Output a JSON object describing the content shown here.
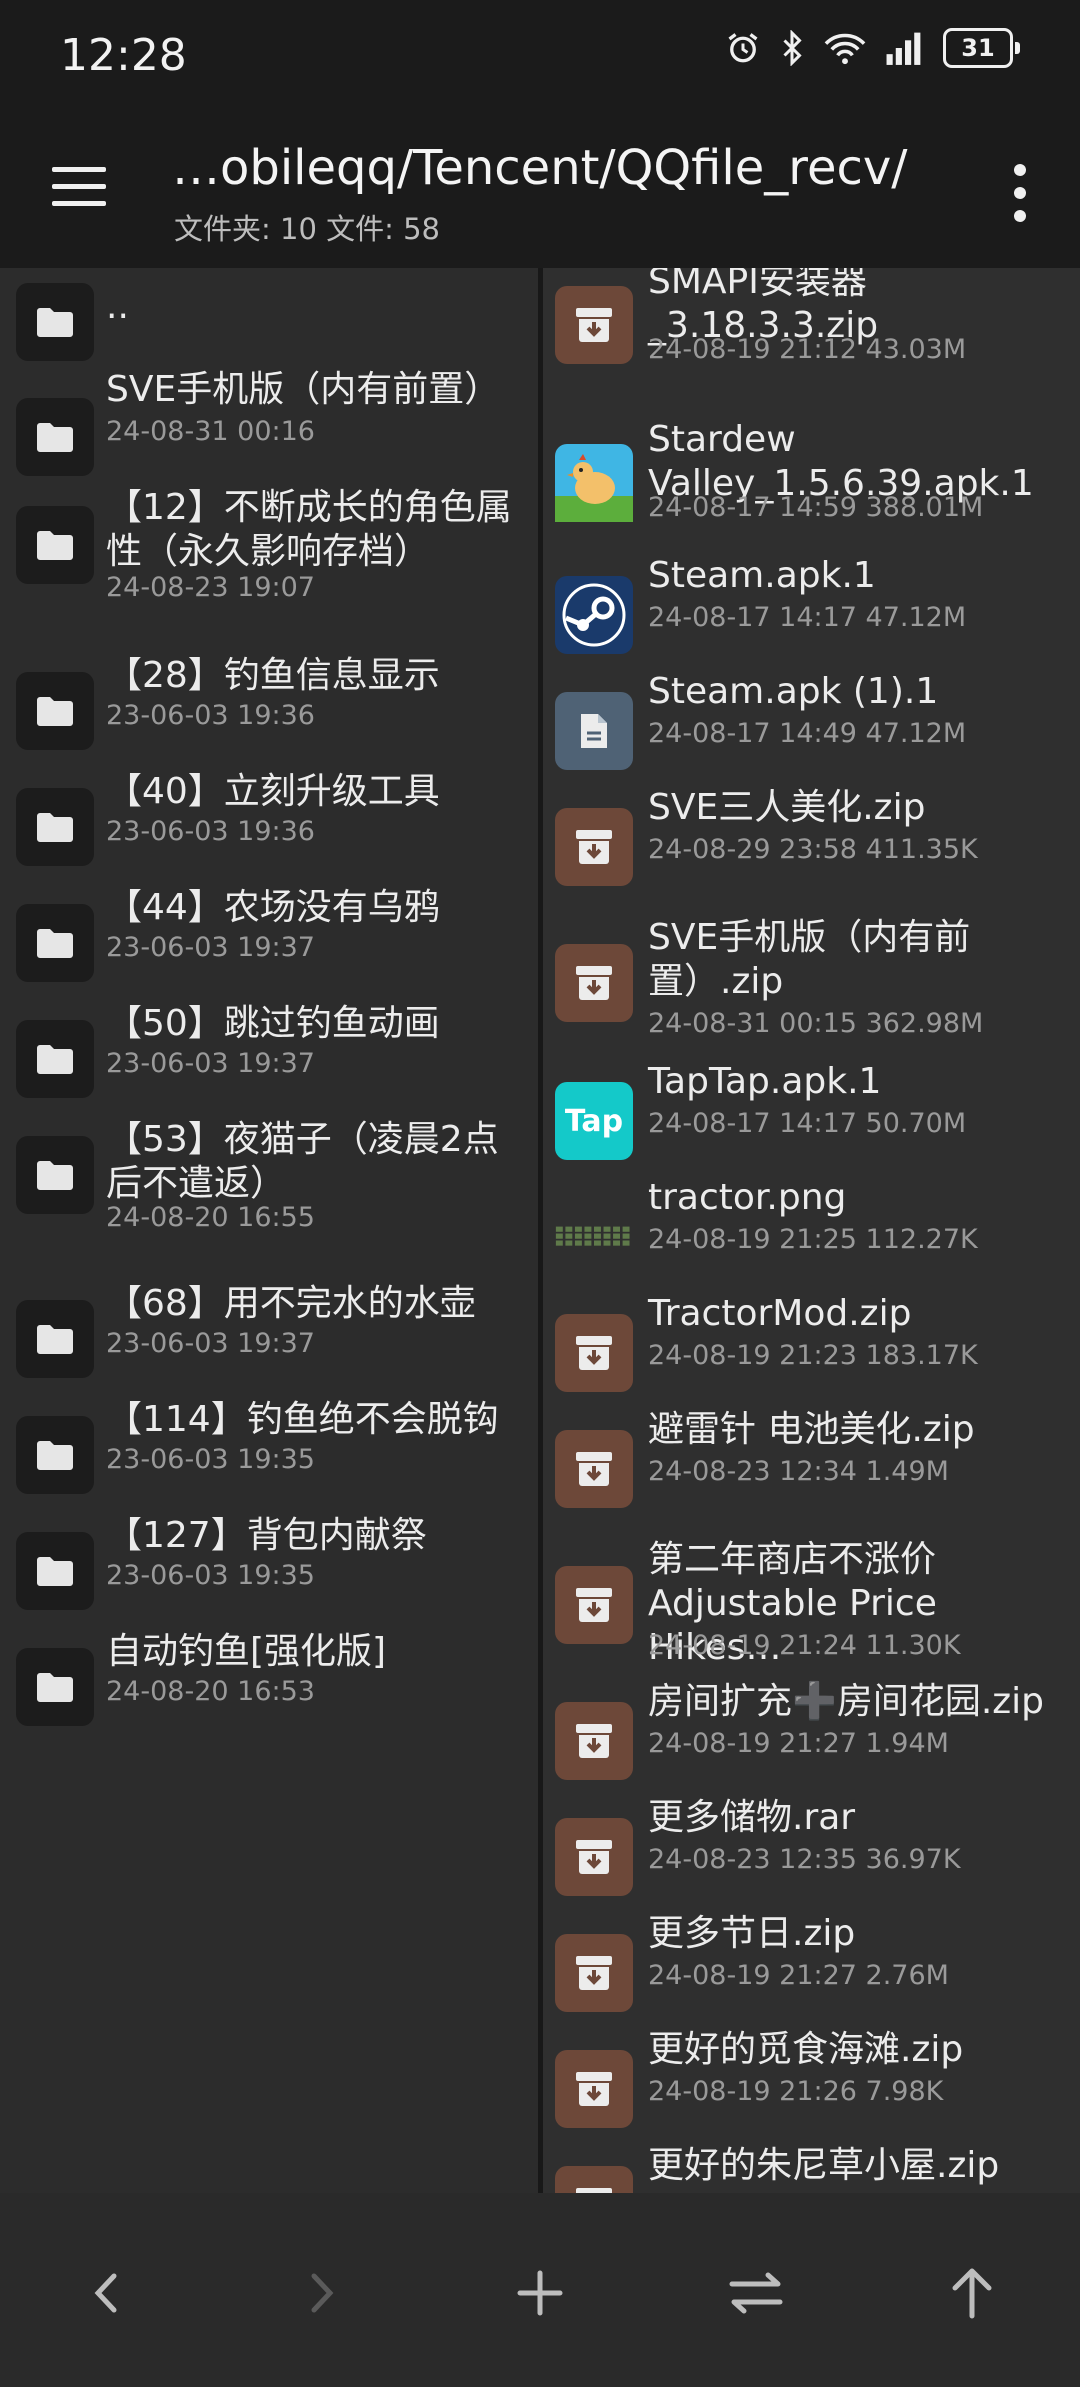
{
  "status": {
    "time": "12:28",
    "battery": "31"
  },
  "header": {
    "path": "…obileqq/Tencent/QQfile_recv/",
    "counts": "文件夹: 10  文件: 58"
  },
  "left": {
    "items": [
      {
        "name": "..",
        "meta": ""
      },
      {
        "name": "SVE手机版（内有前置）",
        "meta": "24-08-31 00:16"
      },
      {
        "name": "【12】不断成长的角色属性（永久影响存档）",
        "meta": "24-08-23 19:07"
      },
      {
        "name": "【28】钓鱼信息显示",
        "meta": "23-06-03 19:36"
      },
      {
        "name": "【40】立刻升级工具",
        "meta": "23-06-03 19:36"
      },
      {
        "name": "【44】农场没有乌鸦",
        "meta": "23-06-03 19:37"
      },
      {
        "name": "【50】跳过钓鱼动画",
        "meta": "23-06-03 19:37"
      },
      {
        "name": "【53】夜猫子（凌晨2点后不遣返）",
        "meta": "24-08-20 16:55"
      },
      {
        "name": "【68】用不完水的水壶",
        "meta": "23-06-03 19:37"
      },
      {
        "name": "【114】钓鱼绝不会脱钩",
        "meta": "23-06-03 19:35"
      },
      {
        "name": "【127】背包内献祭",
        "meta": "23-06-03 19:35"
      },
      {
        "name": "自动钓鱼[强化版]",
        "meta": "24-08-20 16:53"
      }
    ]
  },
  "right": {
    "items": [
      {
        "name": "SMAPI安装器_3.18.3.3.zip",
        "meta": "24-08-19 21:12  43.03M",
        "icon": "archive-icon"
      },
      {
        "name": "Stardew Valley_1.5.6.39.apk.1",
        "meta": "24-08-17 14:59  388.01M",
        "icon": "stardew-app-icon"
      },
      {
        "name": "Steam.apk.1",
        "meta": "24-08-17 14:17  47.12M",
        "icon": "steam-app-icon"
      },
      {
        "name": "Steam.apk (1).1",
        "meta": "24-08-17 14:49  47.12M",
        "icon": "document-icon"
      },
      {
        "name": "SVE三人美化.zip",
        "meta": "24-08-29 23:58  411.35K",
        "icon": "archive-icon"
      },
      {
        "name": "SVE手机版（内有前置）.zip",
        "meta": "24-08-31 00:15  362.98M",
        "icon": "archive-icon"
      },
      {
        "name": "TapTap.apk.1",
        "meta": "24-08-17 14:17  50.70M",
        "icon": "taptap-app-icon",
        "badge": "Tap"
      },
      {
        "name": "tractor.png",
        "meta": "24-08-19 21:25  112.27K",
        "icon": "image-thumbnail-icon"
      },
      {
        "name": "TractorMod.zip",
        "meta": "24-08-19 21:23  183.17K",
        "icon": "archive-icon"
      },
      {
        "name": "避雷针 电池美化.zip",
        "meta": "24-08-23 12:34  1.49M",
        "icon": "archive-icon"
      },
      {
        "name": "第二年商店不涨价 Adjustable Price Hikes…",
        "meta": "24-08-19 21:24  11.30K",
        "icon": "archive-icon"
      },
      {
        "name": "房间扩充➕房间花园.zip",
        "meta": "24-08-19 21:27  1.94M",
        "icon": "archive-icon"
      },
      {
        "name": "更多储物.rar",
        "meta": "24-08-23 12:35  36.97K",
        "icon": "archive-icon"
      },
      {
        "name": "更多节日.zip",
        "meta": "24-08-19 21:27  2.76M",
        "icon": "archive-icon"
      },
      {
        "name": "更好的觅食海滩.zip",
        "meta": "24-08-19 21:26  7.98K",
        "icon": "archive-icon"
      },
      {
        "name": "更好的朱尼草小屋.zip",
        "meta": "",
        "icon": "archive-icon"
      }
    ]
  },
  "colors": {
    "archive": "#6d4839",
    "folder": "#1c1c1c",
    "taptap": "#14c9c9",
    "steam": "#1a3a6b"
  }
}
